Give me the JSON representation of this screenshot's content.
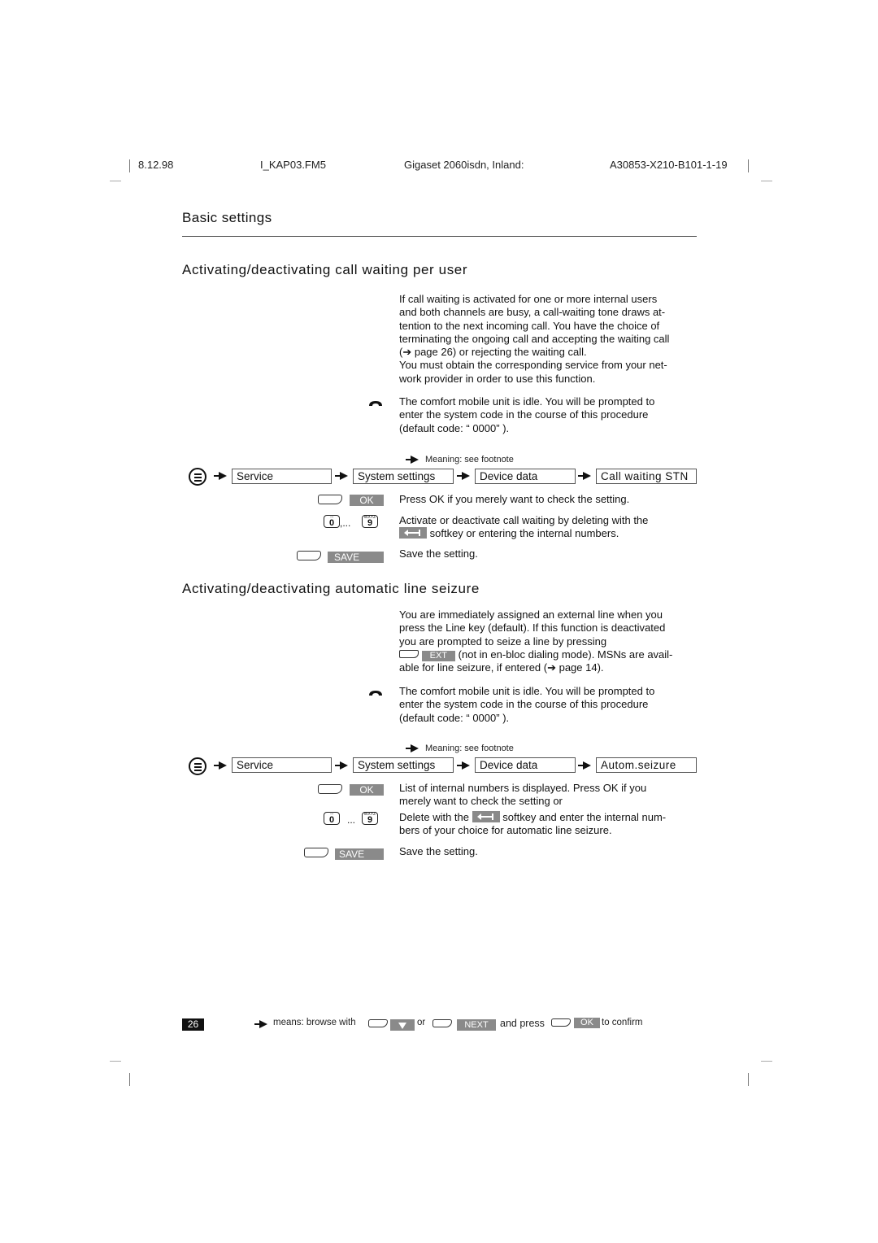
{
  "header": {
    "date": "8.12.98",
    "file": "I_KAP03.FM5",
    "product": "Gigaset 2060isdn, Inland:",
    "doc_number": "A30853-X210-B101-1-19"
  },
  "chapter_title": "Basic settings",
  "sections": [
    {
      "title": "Activating/deactivating call waiting per user",
      "intro_lines": [
        "If call waiting is activated for one or more internal users",
        "and both channels are busy, a call-waiting tone draws at-",
        "tention to the next incoming call. You have the choice of",
        "terminating the ongoing call and accepting the waiting call",
        "(➔ page 26) or rejecting the waiting call.",
        "You must obtain the corresponding service from your net-",
        "work provider in order to use this function."
      ],
      "idle_lines": [
        "The comfort mobile unit is idle. You will be prompted to",
        "enter the system code in the course of this procedure",
        "(default code: “ 0000” )."
      ],
      "footnote_hint": "Meaning: see footnote",
      "menu_path": [
        "Service",
        "System settings",
        "Device data",
        "Call waiting STN"
      ],
      "steps": [
        {
          "key_label": "OK",
          "text": [
            "Press OK if you merely want to check the setting."
          ]
        },
        {
          "key_label": "0 ,... 9",
          "text_before": "Activate or deactivate call waiting by deleting with the",
          "text_after": "softkey or entering the internal numbers."
        },
        {
          "key_label": "SAVE",
          "text": [
            "Save the setting."
          ]
        }
      ]
    },
    {
      "title": "Activating/deactivating automatic line seizure",
      "intro_lines": [
        "You are immediately assigned an external line when you",
        "press the Line key (default). If this function is deactivated",
        "you are prompted to seize a line by pressing"
      ],
      "intro_key": "EXT",
      "intro_after_key": "(not in en-bloc dialing mode). MSNs are avail-",
      "intro_last": "able for line seizure, if entered (➔ page 14).",
      "idle_lines": [
        "The comfort mobile unit is idle. You will be prompted to",
        "enter the system code in the course of this procedure",
        "(default code: “ 0000” )."
      ],
      "footnote_hint": "Meaning: see footnote",
      "menu_path": [
        "Service",
        "System settings",
        "Device data",
        "Autom.seizure"
      ],
      "steps": [
        {
          "key_label": "OK",
          "text": [
            "List of internal numbers is displayed. Press OK if you",
            "merely want to check the setting or"
          ]
        },
        {
          "key_label": "0 ... 9",
          "text_before": "Delete with the",
          "text_after": "softkey and enter the internal num-",
          "text_last": "bers of your choice for automatic line seizure."
        },
        {
          "key_label": "SAVE",
          "text": [
            "Save the setting."
          ]
        }
      ]
    }
  ],
  "numkeys": {
    "zero": "0",
    "nine": "9",
    "zero_sup": "·–",
    "nine_sup": "WXYZ",
    "ellipsis_1": ",...",
    "ellipsis_2": "..."
  },
  "footer": {
    "page_number": "26",
    "means": "means: browse with",
    "or": "or",
    "next_key": "NEXT",
    "and_press": "and press",
    "ok_key": "OK",
    "to_confirm": "to confirm"
  }
}
